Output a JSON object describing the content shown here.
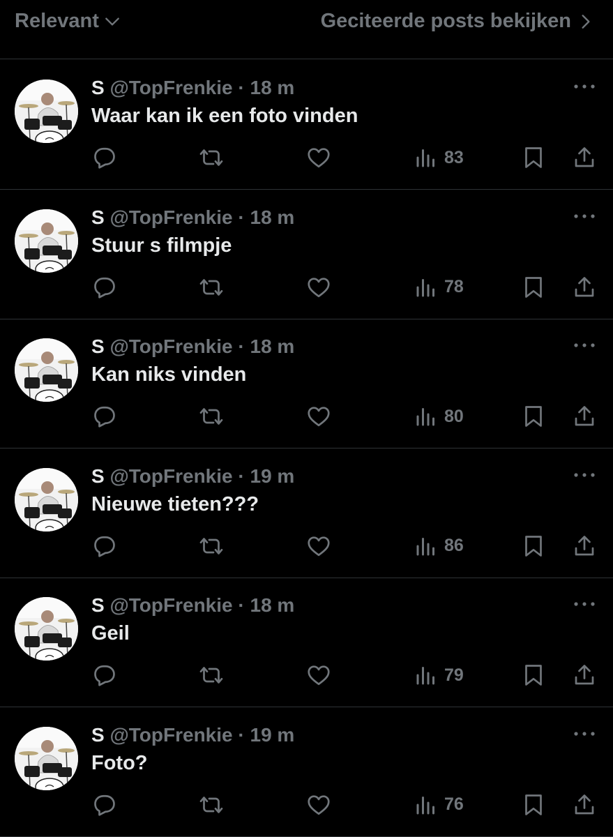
{
  "topbar": {
    "sort_label": "Relevant",
    "quotes_label": "Geciteerde posts bekijken"
  },
  "tweets": [
    {
      "name": "S",
      "handle": "@TopFrenkie",
      "dot": "·",
      "time": "18 m",
      "text": "Waar kan ik een foto vinden",
      "views": "83"
    },
    {
      "name": "S",
      "handle": "@TopFrenkie",
      "dot": "·",
      "time": "18 m",
      "text": "Stuur s filmpje",
      "views": "78"
    },
    {
      "name": "S",
      "handle": "@TopFrenkie",
      "dot": "·",
      "time": "18 m",
      "text": "Kan niks vinden",
      "views": "80"
    },
    {
      "name": "S",
      "handle": "@TopFrenkie",
      "dot": "·",
      "time": "19 m",
      "text": "Nieuwe tieten???",
      "views": "86"
    },
    {
      "name": "S",
      "handle": "@TopFrenkie",
      "dot": "·",
      "time": "18 m",
      "text": "Geil",
      "views": "79"
    },
    {
      "name": "S",
      "handle": "@TopFrenkie",
      "dot": "·",
      "time": "19 m",
      "text": "Foto?",
      "views": "76"
    }
  ],
  "colors": {
    "background": "#000000",
    "text": "#e7e9ea",
    "muted": "#71767b",
    "divider": "#2f3336"
  },
  "icons": [
    "chevron-down-icon",
    "chevron-right-icon",
    "more-icon",
    "reply-icon",
    "repost-icon",
    "like-icon",
    "views-icon",
    "bookmark-icon",
    "share-icon"
  ]
}
